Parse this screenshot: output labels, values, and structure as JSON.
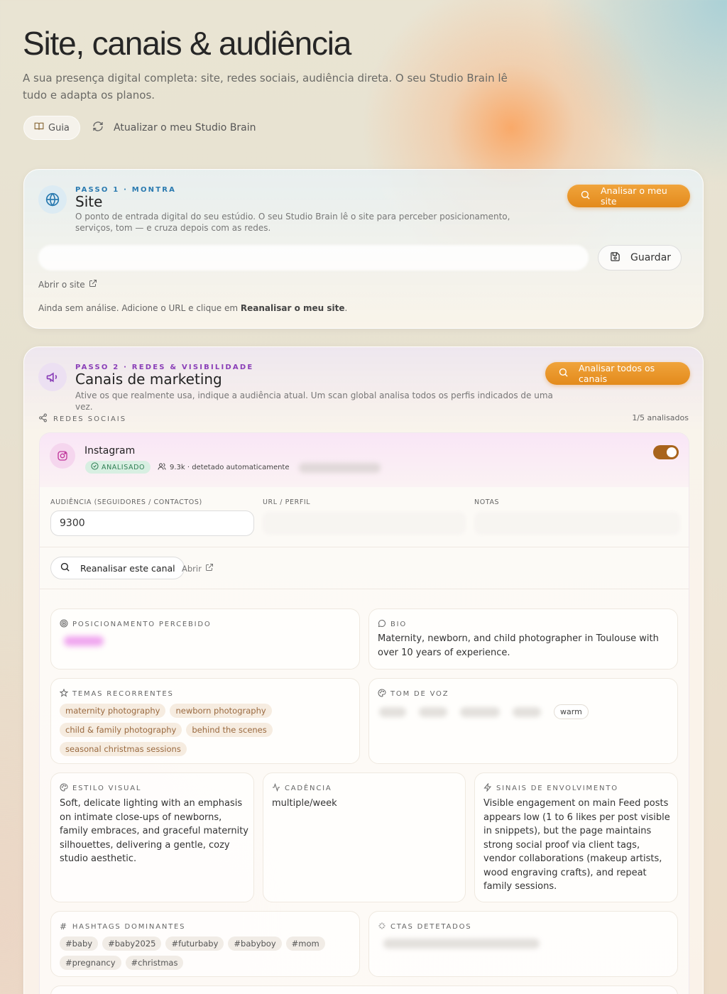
{
  "page": {
    "title": "Site, canais & audiência",
    "subtitle": "A sua presença digital completa: site, redes sociais, audiência direta. O seu Studio Brain lê tudo e adapta os planos.",
    "guide_label": "Guia",
    "update_label": "Atualizar o meu Studio Brain"
  },
  "site": {
    "step": "PASSO 1 · MONTRA",
    "title": "Site",
    "desc": "O ponto de entrada digital do seu estúdio. O seu Studio Brain lê o site para perceber posicionamento, serviços, tom — e cruza depois com as redes.",
    "analyze_label": "Analisar o meu site",
    "save_label": "Guardar",
    "open_label": "Abrir o site",
    "empty_prefix": "Ainda sem análise. Adicione o URL e clique em ",
    "empty_bold": "Reanalisar o meu site",
    "empty_suffix": "."
  },
  "channels": {
    "step": "PASSO 2 · REDES & VISIBILIDADE",
    "title": "Canais de marketing",
    "desc": "Ative os que realmente usa, indique a audiência atual. Um scan global analisa todos os perfis indicados de uma vez.",
    "analyze_label": "Analisar todos os canais",
    "section_label": "REDES SOCIAIS",
    "count_label": "1/5 analisados"
  },
  "instagram": {
    "name": "Instagram",
    "status": "ANALISADO",
    "audience_note": "9.3k · detetado automaticamente",
    "toggle_on": true,
    "labels": {
      "audience": "AUDIÊNCIA (SEGUIDORES / CONTACTOS)",
      "url": "URL / PERFIL",
      "notes": "NOTAS"
    },
    "audience_value": "9300",
    "reanalyze_label": "Reanalisar este canal",
    "open_label": "Abrir",
    "positioning_label": "POSICIONAMENTO PERCEBIDO",
    "bio_label": "BIO",
    "bio": "Maternity, newborn, and child photographer in Toulouse with over 10 years of experience.",
    "themes_label": "TEMAS RECORRENTES",
    "themes": [
      "maternity photography",
      "newborn photography",
      "child & family photography",
      "behind the scenes",
      "seasonal christmas sessions"
    ],
    "tone_label": "TOM DE VOZ",
    "tone_visible": "warm",
    "visual_label": "ESTILO VISUAL",
    "visual": "Soft, delicate lighting with an emphasis on intimate close-ups of newborns, family embraces, and graceful maternity silhouettes, delivering a gentle, cozy studio aesthetic.",
    "cadence_label": "CADÊNCIA",
    "cadence": "multiple/week",
    "engagement_label": "SINAIS DE ENVOLVIMENTO",
    "engagement": "Visible engagement on main Feed posts appears low (1 to 6 likes per post visible in snippets), but the page maintains strong social proof via client tags, vendor collaborations (makeup artists, wood engraving crafts), and repeat family sessions.",
    "hashtags_label": "HASHTAGS DOMINANTES",
    "hashtags": [
      "#baby",
      "#baby2025",
      "#futurbaby",
      "#babyboy",
      "#mom",
      "#pregnancy",
      "#christmas"
    ],
    "ctas_label": "CTAS DETETADOS"
  },
  "colors": {
    "accent": "#e8961f",
    "site_step": "#2a7ab0",
    "channels_step": "#8a3fb8",
    "toggle": "#a8641c"
  }
}
